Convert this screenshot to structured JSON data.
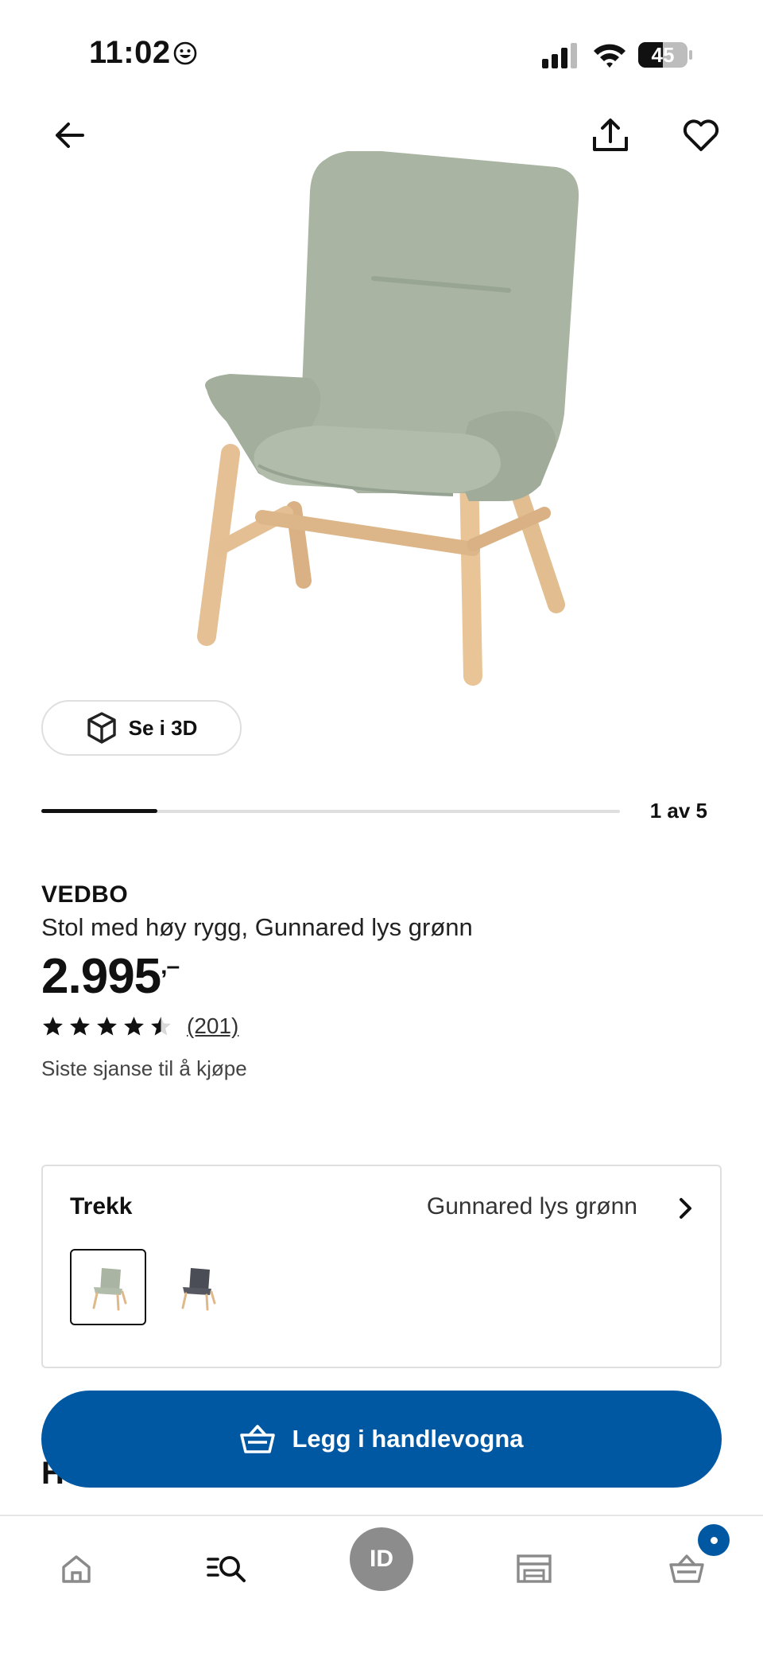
{
  "status_bar": {
    "time": "11:02",
    "battery": "45"
  },
  "product": {
    "name": "VEDBO",
    "description": "Stol med høy rygg, Gunnared lys grønn",
    "price": "2.995",
    "price_suffix": ",–",
    "rating": 4.5,
    "rating_max": 5,
    "review_count": "(201)",
    "notice": "Siste sjanse til å kjøpe"
  },
  "gallery": {
    "view_3d_label": "Se i 3D",
    "position_text": "1 av 5",
    "current": 1,
    "total": 5
  },
  "cover": {
    "label": "Trekk",
    "selected_value": "Gunnared lys grønn",
    "options": [
      "Gunnared lys grønn",
      "Gunnared mørk grå"
    ]
  },
  "partial_heading": "H",
  "cart_button": {
    "label": "Legg i handlevogna"
  },
  "tabbar": {
    "id_label": "ID",
    "items": [
      "home-icon",
      "search-list-icon",
      "id-avatar",
      "store-icon",
      "cart-icon"
    ]
  },
  "colors": {
    "brand_blue": "#0058a3",
    "chair_fabric": "#a7b3a0",
    "chair_wood": "#e0b98a"
  }
}
